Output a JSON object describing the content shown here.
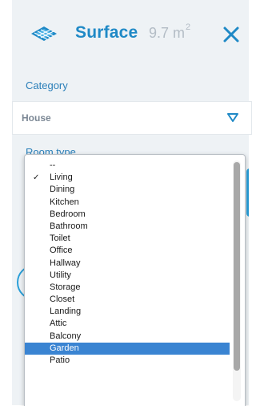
{
  "header": {
    "title": "Surface",
    "area_value": "9.7 m",
    "area_unit_exp": "2",
    "icon": "surface-layers-icon",
    "close_icon": "close-icon"
  },
  "category": {
    "label": "Category",
    "selected": "House"
  },
  "room_type": {
    "label": "Room type",
    "options": [
      {
        "label": "--",
        "checked": false,
        "highlighted": false
      },
      {
        "label": "Living",
        "checked": true,
        "highlighted": false
      },
      {
        "label": "Dining",
        "checked": false,
        "highlighted": false
      },
      {
        "label": "Kitchen",
        "checked": false,
        "highlighted": false
      },
      {
        "label": "Bedroom",
        "checked": false,
        "highlighted": false
      },
      {
        "label": "Bathroom",
        "checked": false,
        "highlighted": false
      },
      {
        "label": "Toilet",
        "checked": false,
        "highlighted": false
      },
      {
        "label": "Office",
        "checked": false,
        "highlighted": false
      },
      {
        "label": "Hallway",
        "checked": false,
        "highlighted": false
      },
      {
        "label": "Utility",
        "checked": false,
        "highlighted": false
      },
      {
        "label": "Storage",
        "checked": false,
        "highlighted": false
      },
      {
        "label": "Closet",
        "checked": false,
        "highlighted": false
      },
      {
        "label": "Landing",
        "checked": false,
        "highlighted": false
      },
      {
        "label": "Attic",
        "checked": false,
        "highlighted": false
      },
      {
        "label": "Balcony",
        "checked": false,
        "highlighted": false
      },
      {
        "label": "Garden",
        "checked": false,
        "highlighted": true
      },
      {
        "label": "Patio",
        "checked": false,
        "highlighted": false
      }
    ]
  },
  "colors": {
    "accent": "#1f89c6",
    "label": "#2a7fb9",
    "highlight": "#3a84d2",
    "panel_bg": "#eef2f5"
  }
}
